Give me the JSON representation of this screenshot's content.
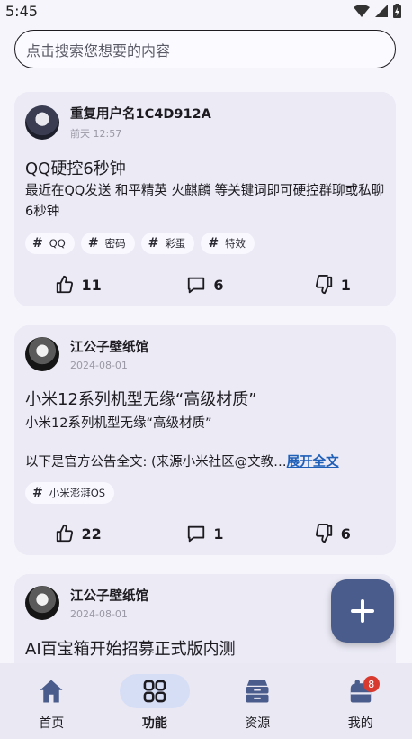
{
  "status_bar": {
    "time": "5:45"
  },
  "search": {
    "placeholder": "点击搜索您想要的内容"
  },
  "posts": [
    {
      "author": "重复用户名1C4D912A",
      "time": "前天 12:57",
      "title": "QQ硬控6秒钟",
      "body": "最近在QQ发送 和平精英 火麒麟 等关键词即可硬控群聊或私聊6秒钟",
      "tags": [
        "QQ",
        "密码",
        "彩蛋",
        "特效"
      ],
      "likes": "11",
      "comments": "6",
      "dislikes": "1"
    },
    {
      "author": "江公子壁纸馆",
      "time": "2024-08-01",
      "title": "小米12系列机型无缘“高级材质”",
      "subtitle": "小米12系列机型无缘“高级材质”",
      "body": "以下是官方公告全文: (来源小米社区@文教…",
      "expand": "展开全文",
      "tags": [
        "小米澎湃OS"
      ],
      "likes": "22",
      "comments": "1",
      "dislikes": "6"
    },
    {
      "author": "江公子壁纸馆",
      "time": "2024-08-01",
      "title": "AI百宝箱开始招募正式版内测"
    }
  ],
  "nav": [
    {
      "label": "首页",
      "icon": "home-icon"
    },
    {
      "label": "功能",
      "icon": "grid-icon"
    },
    {
      "label": "资源",
      "icon": "archive-icon"
    },
    {
      "label": "我的",
      "icon": "profile-icon",
      "badge": "8"
    }
  ],
  "colors": {
    "accent": "#4a5c8c",
    "card": "#ebeaf5",
    "badge": "#d93a2f"
  }
}
